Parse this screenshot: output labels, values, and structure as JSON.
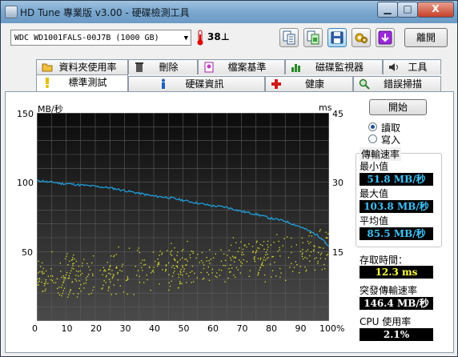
{
  "window": {
    "title": "HD Tune 專業版 v3.00 - 硬碟檢測工具",
    "buttons": {
      "minimize": "▁",
      "maximize": "□",
      "close": "X"
    }
  },
  "toolbar": {
    "drive": "WDC WD1001FALS-00J7B (1000 GB)",
    "temperature": "38⊥",
    "exit_label": "離開",
    "icons": [
      "copy-text-icon",
      "copy-screenshot-icon",
      "save-icon",
      "options-icon",
      "download-icon"
    ]
  },
  "tabs_row1": [
    "資料夾使用率",
    "刪除",
    "檔案基準",
    "磁碟監視器",
    "工具"
  ],
  "tabs_row2": [
    "標準測試",
    "硬碟資訊",
    "健康",
    "錯誤掃描"
  ],
  "active_tab": "標準測試",
  "controls": {
    "start_label": "開始",
    "read_label": "讀取",
    "write_label": "寫入",
    "mode": "read"
  },
  "stats": {
    "transfer_rate_label": "傳輸速率",
    "min_label": "最小值",
    "min_value": "51.8 MB/秒",
    "max_label": "最大值",
    "max_value": "103.8 MB/秒",
    "avg_label": "平均值",
    "avg_value": "85.5 MB/秒",
    "access_label": "存取時間：",
    "access_value": "12.3 ms",
    "burst_label": "突發傳輸速率",
    "burst_value": "146.4 MB/秒",
    "cpu_label": "CPU 使用率",
    "cpu_value": "2.1%"
  },
  "colors": {
    "transfer_line": "#1ea6e6",
    "access_points": "#e6e62a",
    "chart_bg_top": "#0b0b0b",
    "chart_bg_bottom": "#4a4a4a",
    "grid": "#5c5c5c"
  },
  "chart_data": {
    "type": "line",
    "title": "",
    "ylabel": "MB/秒",
    "ylabel_right": "ms",
    "xlim": [
      0,
      100
    ],
    "ylim": [
      0,
      150
    ],
    "ylim_right": [
      0,
      45
    ],
    "x_ticks": [
      "0",
      "10",
      "20",
      "30",
      "40",
      "50",
      "60",
      "70",
      "80",
      "90",
      "100%"
    ],
    "y_ticks": [
      "150",
      "100",
      "50"
    ],
    "y_ticks_right": [
      "45",
      "30",
      "15"
    ],
    "grid": true,
    "series": [
      {
        "name": "transfer rate (MB/s)",
        "axis": "left",
        "x": [
          0,
          2,
          4,
          6,
          8,
          10,
          15,
          20,
          25,
          30,
          35,
          40,
          45,
          50,
          55,
          60,
          65,
          70,
          75,
          80,
          85,
          90,
          95,
          98,
          100
        ],
        "y": [
          101,
          101,
          100,
          100,
          99,
          99,
          98,
          97,
          96,
          94,
          92,
          90,
          89,
          87,
          85,
          83,
          82,
          79,
          77,
          74,
          72,
          68,
          63,
          59,
          53
        ]
      },
      {
        "name": "access time (ms)",
        "axis": "right",
        "type": "scatter",
        "trend_x": [
          0,
          20,
          40,
          60,
          80,
          100
        ],
        "trend_y": [
          9.5,
          10.5,
          11.5,
          12.8,
          14.0,
          15.5
        ],
        "spread": 4.5
      }
    ]
  }
}
